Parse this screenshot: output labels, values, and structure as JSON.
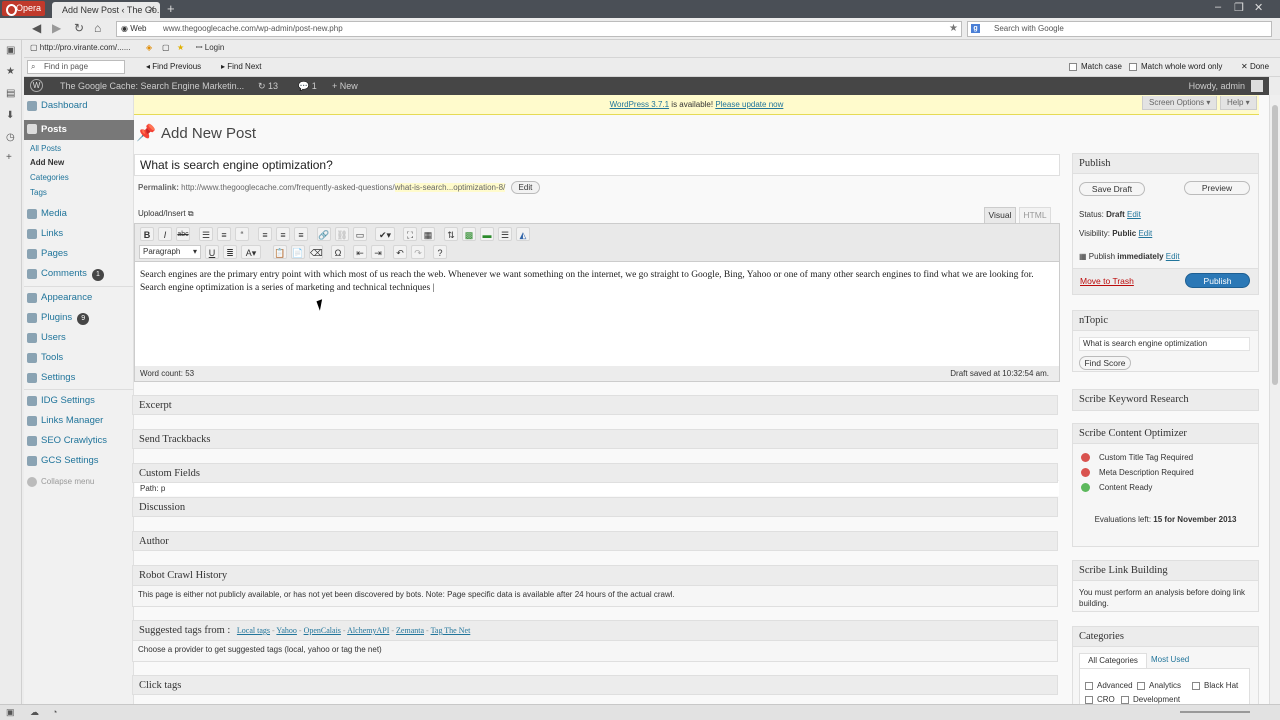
{
  "browser": {
    "opera_label": "Opera",
    "tab_title": "Add New Post ‹ The Go...",
    "url_prefix": "Web",
    "url": "www.thegooglecache.com/wp-admin/post-new.php",
    "search_placeholder": "Search with Google",
    "bookmark1": "http://pro.virante.com/......",
    "bookmark2": "Login",
    "find_placeholder": "Find in page",
    "find_previous": "Find Previous",
    "find_next": "Find Next",
    "match_case": "Match case",
    "match_whole_word": "Match whole word only",
    "done": "Done"
  },
  "adminbar": {
    "site_name": "The Google Cache: Search Engine Marketin...",
    "updates": "13",
    "comments": "1",
    "new": "New",
    "howdy": "Howdy, admin"
  },
  "menu": {
    "dashboard": "Dashboard",
    "posts": "Posts",
    "all_posts": "All Posts",
    "add_new": "Add New",
    "categories": "Categories",
    "tags": "Tags",
    "media": "Media",
    "links": "Links",
    "pages": "Pages",
    "comments": "Comments",
    "comments_count": "1",
    "appearance": "Appearance",
    "plugins": "Plugins",
    "plugins_count": "9",
    "users": "Users",
    "tools": "Tools",
    "settings": "Settings",
    "idg_settings": "IDG Settings",
    "links_manager": "Links Manager",
    "seo_crawlytics": "SEO Crawlytics",
    "gcs_settings": "GCS Settings",
    "collapse": "Collapse menu"
  },
  "notice": {
    "link1": "WordPress 3.7.1",
    "text": " is available! ",
    "link2": "Please update now"
  },
  "screen_options": "Screen Options",
  "help": "Help",
  "page_title": "Add New Post",
  "post": {
    "title": "What is search engine optimization?",
    "permalink_label": "Permalink:",
    "permalink_base": "http://www.thegooglecache.com/frequently-asked-questions/",
    "permalink_slug": "what-is-search...optimization-8/",
    "edit": "Edit",
    "upload_insert": "Upload/Insert",
    "tab_visual": "Visual",
    "tab_html": "HTML",
    "format": "Paragraph",
    "content": "Search engines are the primary entry point with which most of us reach the web. Whenever we want something on the internet, we go straight to Google, Bing, Yahoo or one of many other search engines to find what we are looking for. Search engine optimization is a series of marketing and technical techniques |",
    "path": "Path: p",
    "word_count": "Word count: 53",
    "draft_saved": "Draft saved at 10:32:54 am."
  },
  "boxes": {
    "excerpt": "Excerpt",
    "trackbacks": "Send Trackbacks",
    "custom_fields": "Custom Fields",
    "discussion": "Discussion",
    "author": "Author",
    "robot": "Robot Crawl History",
    "robot_text": "This page is either not publicly available, or has not yet been discovered by bots. Note: Page specific data is available after 24 hours of the actual crawl.",
    "suggested": "Suggested tags from :",
    "providers": [
      "Local tags",
      "Yahoo",
      "OpenCalais",
      "AlchemyAPI",
      "Zemanta",
      "Tag The Net"
    ],
    "suggested_text": "Choose a provider to get suggested tags (local, yahoo or tag the net)",
    "click_tags": "Click tags"
  },
  "publish": {
    "heading": "Publish",
    "save_draft": "Save Draft",
    "preview": "Preview",
    "status_label": "Status:",
    "status_value": "Draft",
    "visibility_label": "Visibility:",
    "visibility_value": "Public",
    "edit": "Edit",
    "publish_label": "Publish",
    "publish_when": "immediately",
    "trash": "Move to Trash",
    "publish_btn": "Publish"
  },
  "ntopic": {
    "heading": "nTopic",
    "input": "What is search engine optimization",
    "find_score": "Find Score"
  },
  "scribe": {
    "keyword_heading": "Scribe Keyword Research",
    "optimizer_heading": "Scribe Content Optimizer",
    "items": [
      "Custom Title Tag Required",
      "Meta Description Required",
      "Content Ready"
    ],
    "evaluations_label": "Evaluations left:",
    "evaluations_value": "15 for November 2013",
    "link_heading": "Scribe Link Building",
    "link_text": "You must perform an analysis before doing link building."
  },
  "categories": {
    "heading": "Categories",
    "tab_all": "All Categories",
    "tab_most": "Most Used",
    "items": [
      "Advanced",
      "Analytics",
      "Black Hat",
      "CRO",
      "Development"
    ]
  },
  "colors": {
    "adminbar": "#464646",
    "link": "#21759b",
    "publish": "#2b78b6",
    "error": "#d9534f",
    "ok": "#5cb85c"
  }
}
